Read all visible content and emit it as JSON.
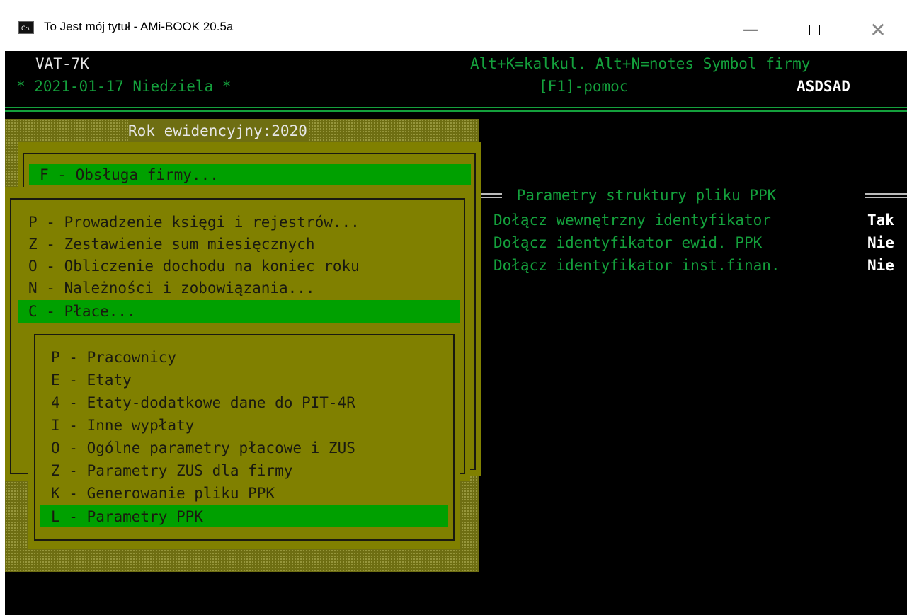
{
  "window": {
    "title": "To Jest mój tytuł - AMi-BOOK 20.5a",
    "icon": "console-app-icon",
    "icon_text": "C:\\."
  },
  "header": {
    "doc_type": "VAT-7K",
    "date_line": "* 2021-01-17 Niedziela *",
    "shortcuts": "Alt+K=kalkul. Alt+N=notes Symbol firmy",
    "help": "[F1]-pomoc",
    "company_symbol": "ASDSAD"
  },
  "year_label": "Rok ewidencyjny:2020",
  "main_menu": {
    "top_item": "F - Obsługa firmy...",
    "items": [
      "P - Prowadzenie księgi i rejestrów...",
      "Z - Zestawienie sum miesięcznych",
      "O - Obliczenie dochodu na koniec roku",
      "N - Należności i zobowiązania...",
      "C - Płace..."
    ],
    "selected_index": 4
  },
  "submenu": {
    "items": [
      "P - Pracownicy",
      "E - Etaty",
      "4 - Etaty-dodatkowe dane do PIT-4R",
      "I - Inne wypłaty",
      "O - Ogólne parametry płacowe i ZUS",
      "Z - Parametry ZUS dla firmy",
      "K - Generowanie pliku PPK",
      "L - Parametry PPK"
    ],
    "selected_index": 7
  },
  "ppk_params": {
    "title": " Parametry struktury pliku PPK ",
    "rows": [
      {
        "label": "Dołącz wewnętrzny identyfikator",
        "value": "Tak"
      },
      {
        "label": "Dołącz identyfikator ewid. PPK",
        "value": "Nie"
      },
      {
        "label": "Dołącz identyfikator inst.finan.",
        "value": "Nie"
      }
    ]
  },
  "colors": {
    "console_bg": "#000000",
    "console_green": "#14a03c",
    "menu_olive": "#808000",
    "highlight_green": "#00a000"
  }
}
